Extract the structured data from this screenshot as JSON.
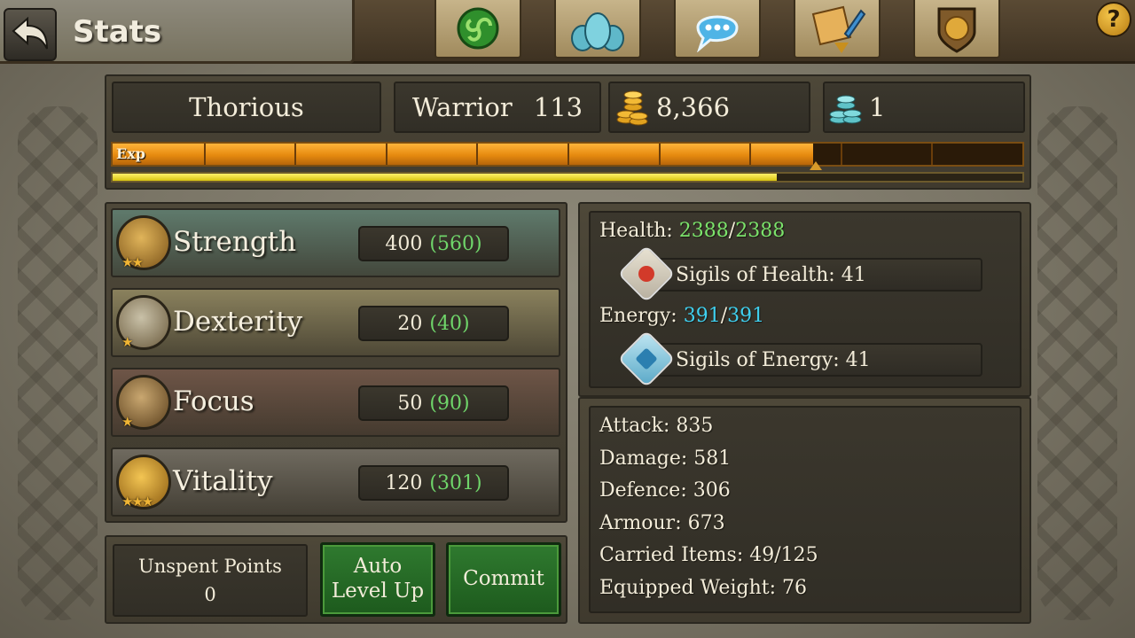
{
  "header": {
    "title": "Stats",
    "nav": [
      {
        "name": "triskelion-icon",
        "color": "#3fae3a"
      },
      {
        "name": "party-icon",
        "color": "#4fb5c8"
      },
      {
        "name": "chat-icon",
        "color": "#4fb7e8"
      },
      {
        "name": "quest-scroll-icon",
        "color": "#e0a33a"
      },
      {
        "name": "guild-shield-icon",
        "color": "#c9962e"
      }
    ],
    "help_label": "?"
  },
  "character": {
    "name": "Thorious",
    "class": "Warrior",
    "level": "113",
    "gold": "8,366",
    "platinum": "1"
  },
  "experience": {
    "label": "Exp",
    "progress": 0.77,
    "secondary_progress": 0.73,
    "segments": 10
  },
  "attributes": [
    {
      "name": "Strength",
      "base": "400",
      "total": "(560)",
      "stars": "★★",
      "color": "#5f7a6c"
    },
    {
      "name": "Dexterity",
      "base": "20",
      "total": "(40)",
      "stars": "★",
      "color": "#8a815d"
    },
    {
      "name": "Focus",
      "base": "50",
      "total": "(90)",
      "stars": "★",
      "color": "#6e5547"
    },
    {
      "name": "Vitality",
      "base": "120",
      "total": "(301)",
      "stars": "★★★",
      "color": "#6f6a5f"
    }
  ],
  "points": {
    "label": "Unspent Points",
    "value": "0"
  },
  "buttons": {
    "auto_level_up_line1": "Auto",
    "auto_level_up_line2": "Level Up",
    "commit": "Commit"
  },
  "vitals": {
    "health_label": "Health:",
    "health_current": "2388",
    "separator": "/",
    "health_max": "2388",
    "sigils_health": "Sigils of Health: 41",
    "energy_label": "Energy:",
    "energy_current": "391",
    "energy_max": "391",
    "sigils_energy": "Sigils of Energy: 41"
  },
  "combat": [
    "Attack: 835",
    "Damage: 581",
    "Defence: 306",
    "Armour: 673",
    "Carried Items: 49/125",
    "Equipped Weight: 76"
  ]
}
